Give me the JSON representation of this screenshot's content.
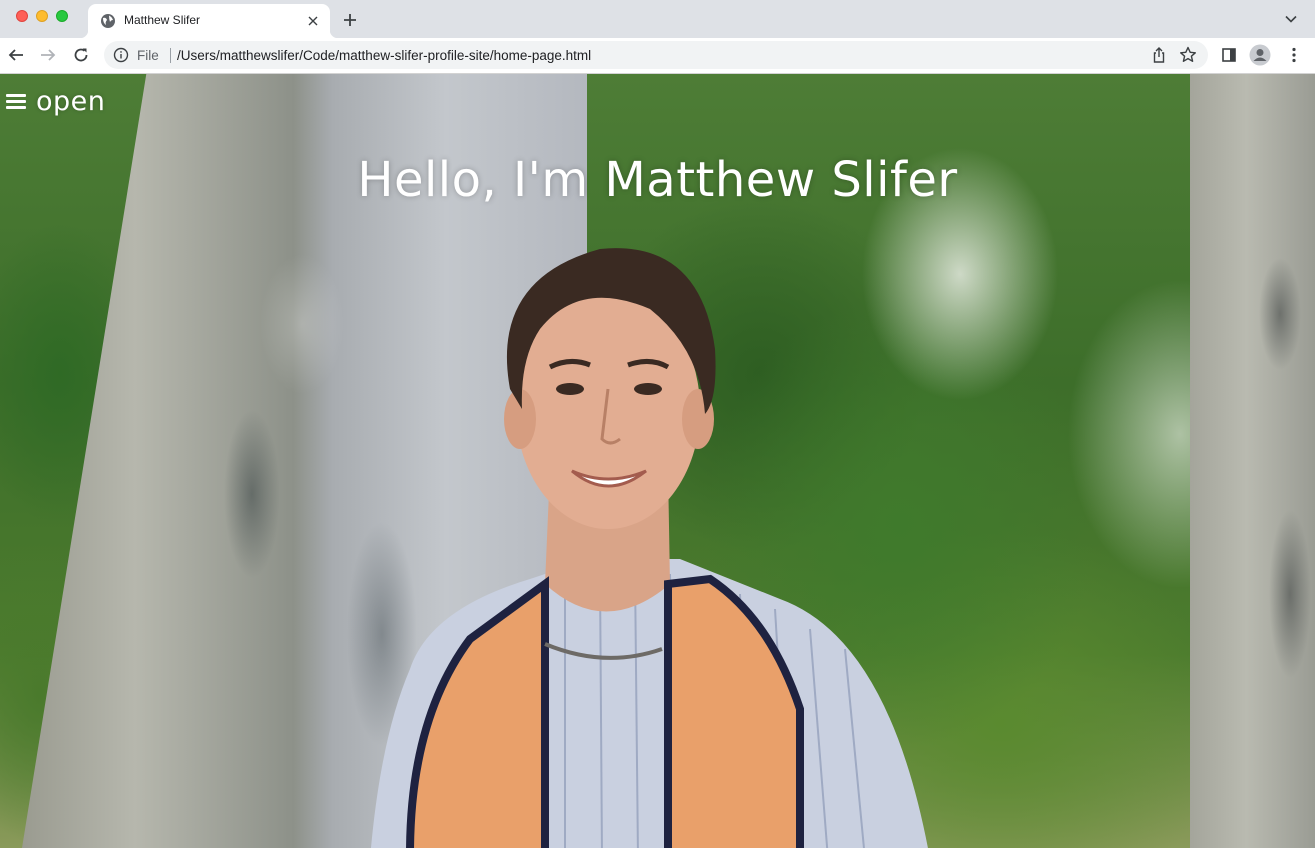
{
  "window": {
    "tab_title": "Matthew Slifer"
  },
  "address_bar": {
    "scheme_label": "File",
    "url": "/Users/matthewslifer/Code/matthew-slifer-profile-site/home-page.html"
  },
  "page": {
    "menu_toggle_label": "open",
    "hero_title": "Hello, I'm Matthew Slifer"
  },
  "icons": {
    "tab_favicon": "globe-icon",
    "tab_close": "close-icon",
    "new_tab": "plus-icon",
    "tab_search": "chevron-down-icon",
    "back": "arrow-left-icon",
    "forward": "arrow-right-icon",
    "reload": "reload-icon",
    "site_info": "info-icon",
    "share": "share-icon",
    "bookmark": "star-icon",
    "side_panel": "side-panel-icon",
    "profile": "profile-icon",
    "menu": "kebab-menu-icon",
    "hamburger": "hamburger-icon"
  },
  "colors": {
    "tabstrip": "#dee1e6",
    "toolbar": "#ffffff",
    "omnibox": "#f1f3f4",
    "hero_text": "#ffffff"
  }
}
